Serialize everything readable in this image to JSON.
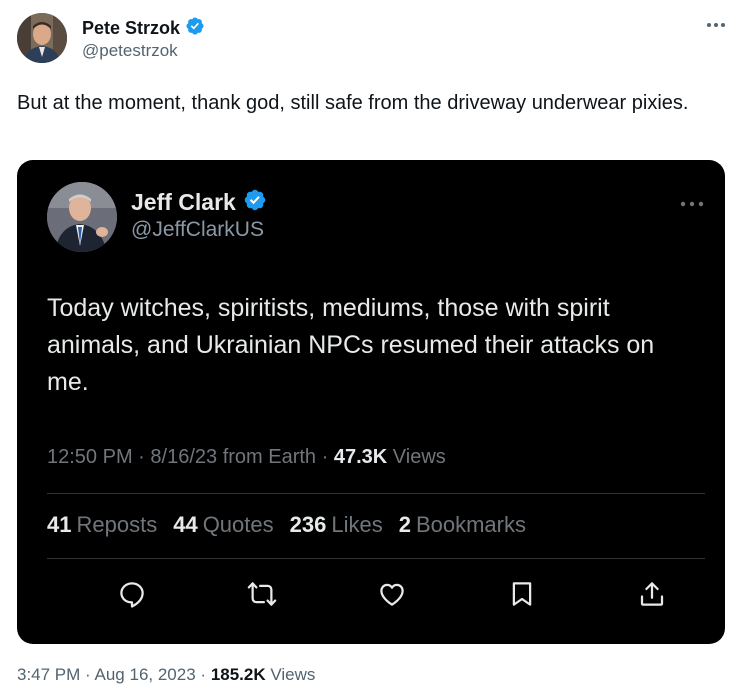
{
  "outer_tweet": {
    "author_name": "Pete Strzok",
    "handle": "@petestrzok",
    "text": "But at the moment, thank god, still safe from the driveway underwear pixies.",
    "time": "3:47 PM",
    "separator": "·",
    "date": "Aug 16, 2023",
    "views_count": "185.2K",
    "views_label": "Views"
  },
  "quoted_tweet": {
    "author_name": "Jeff Clark",
    "handle": "@JeffClarkUS",
    "text": "Today witches, spiritists, mediums, those with spirit animals, and Ukrainian NPCs resumed their attacks on me.",
    "time": "12:50 PM",
    "separator": "·",
    "date_source": "8/16/23 from Earth",
    "views_count": "47.3K",
    "views_label": "Views",
    "stats": {
      "reposts_count": "41",
      "reposts_label": "Reposts",
      "quotes_count": "44",
      "quotes_label": "Quotes",
      "likes_count": "236",
      "likes_label": "Likes",
      "bookmarks_count": "2",
      "bookmarks_label": "Bookmarks"
    }
  },
  "colors": {
    "verified_badge": "#1d9bf0",
    "quote_background": "#000000",
    "secondary_text": "#536471"
  },
  "icons": {
    "verified": "verified-badge-icon",
    "more": "more-icon",
    "reply": "reply-icon",
    "repost": "repost-icon",
    "like": "heart-icon",
    "bookmark": "bookmark-icon",
    "share": "share-icon"
  }
}
